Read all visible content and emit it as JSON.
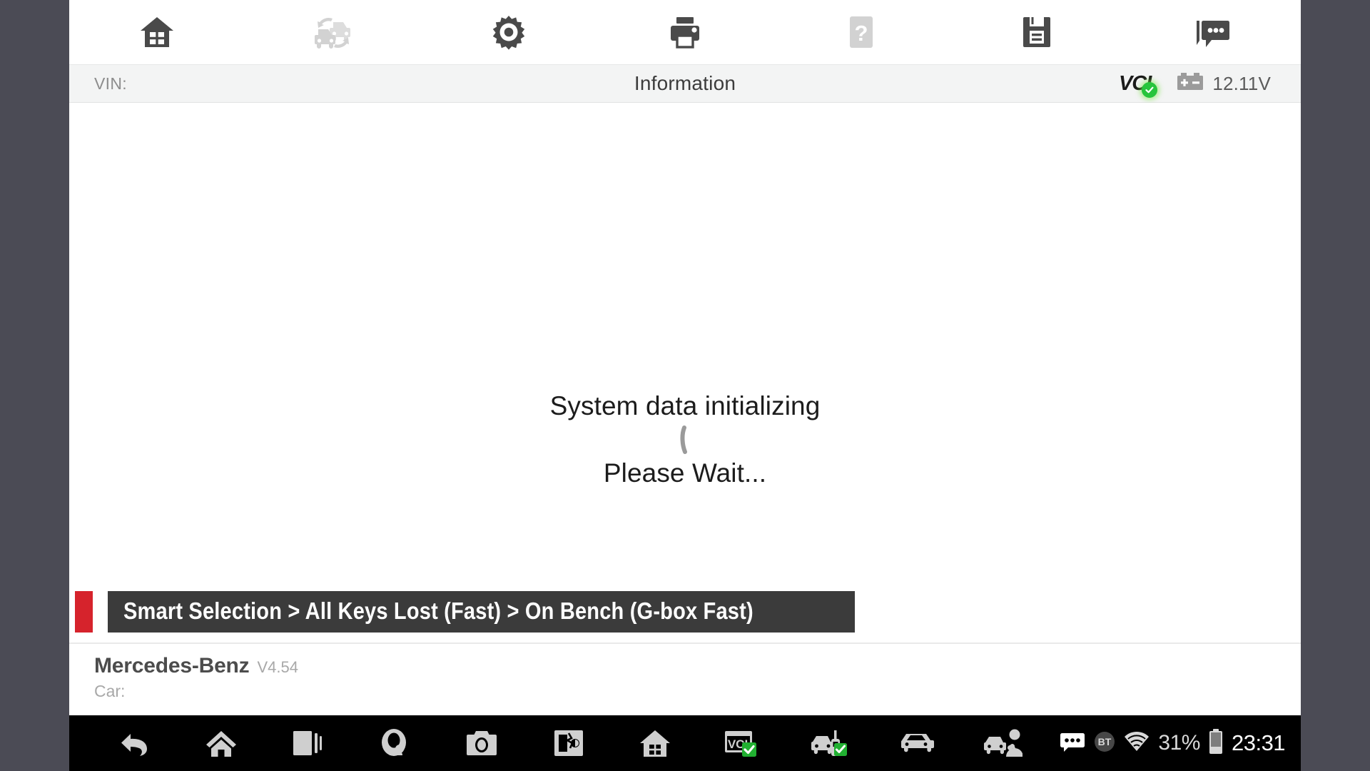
{
  "frame": {
    "margin_color": "#4b4b55",
    "content_bg": "#ffffff"
  },
  "toolbar": {
    "items": [
      {
        "name": "home-icon",
        "label": "Home",
        "state": "enabled"
      },
      {
        "name": "vehicle-swap-icon",
        "label": "Vehicle Swap",
        "state": "disabled"
      },
      {
        "name": "gear-icon",
        "label": "Settings",
        "state": "enabled"
      },
      {
        "name": "printer-icon",
        "label": "Print",
        "state": "enabled"
      },
      {
        "name": "help-icon",
        "label": "Help",
        "state": "disabled"
      },
      {
        "name": "save-icon",
        "label": "Save",
        "state": "enabled"
      },
      {
        "name": "feedback-icon",
        "label": "Feedback",
        "state": "enabled"
      }
    ]
  },
  "infobar": {
    "vin_label": "VIN:",
    "vin_value": "",
    "title": "Information",
    "vci_label": "VCI",
    "vci_connected": true,
    "battery_voltage": "12.11V",
    "accent_green": "#27c43c"
  },
  "stage": {
    "line1": "System data initializing",
    "line2": "Please Wait...",
    "spinner_visible": true
  },
  "breadcrumb": {
    "text": "Smart Selection > All Keys Lost (Fast) > On Bench (G-box Fast)",
    "accent_color": "#d6232c",
    "box_color": "#3b3b3b"
  },
  "vehicle_footer": {
    "make": "Mercedes-Benz",
    "version": "V4.54",
    "car_label": "Car:",
    "car_value": ""
  },
  "navbar": {
    "buttons": [
      {
        "name": "back-icon",
        "label": "Back"
      },
      {
        "name": "home-icon",
        "label": "Home"
      },
      {
        "name": "recents-icon",
        "label": "Recent Apps"
      },
      {
        "name": "cloud-user-icon",
        "label": "Cloud Account"
      },
      {
        "name": "camera-icon",
        "label": "Camera"
      },
      {
        "name": "screenshot-icon",
        "label": "Screenshot"
      },
      {
        "name": "app-home-icon",
        "label": "App Home"
      },
      {
        "name": "vci-status-icon",
        "label": "VCI Connected"
      },
      {
        "name": "vehicle-key-icon",
        "label": "Vehicle Key Linked"
      },
      {
        "name": "vehicle-icon",
        "label": "Vehicle"
      },
      {
        "name": "vehicle-service-icon",
        "label": "Vehicle Service"
      }
    ],
    "status": {
      "messages_icon": "messages-icon",
      "bluetooth_label": "BT",
      "wifi_icon": "wifi-icon",
      "battery_percent": "31%",
      "clock": "23:31"
    }
  }
}
